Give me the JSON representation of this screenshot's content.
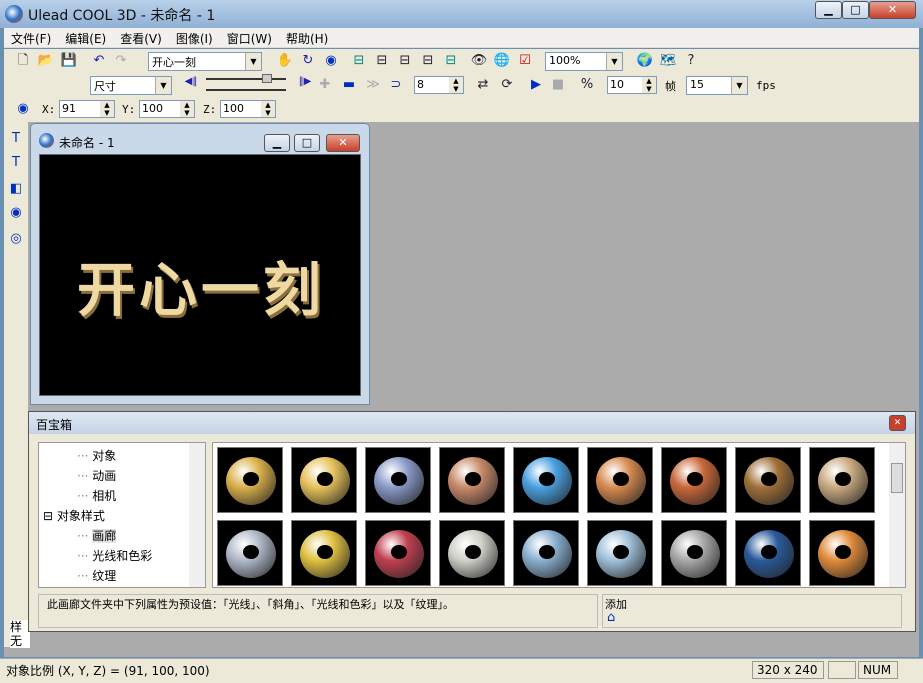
{
  "window": {
    "title": "Ulead COOL 3D - 未命名 - 1",
    "min": "▁",
    "max": "□",
    "close": "✕"
  },
  "menu": [
    "文件(F)",
    "编辑(E)",
    "查看(V)",
    "图像(I)",
    "窗口(W)",
    "帮助(H)"
  ],
  "toolbar1": {
    "text_combo": "开心一刻",
    "zoom_combo": "100%"
  },
  "toolbar2": {
    "attr_combo": "尺寸",
    "frame_value": "8",
    "frames_count": "10",
    "frames_label": "帧",
    "fps_value": "15",
    "fps_label": "fps"
  },
  "toolbar3": {
    "x_label": "X:",
    "x_value": "91",
    "y_label": "Y:",
    "y_value": "100",
    "z_label": "Z:",
    "z_value": "100"
  },
  "document": {
    "title": "未命名 - 1",
    "text": "开心一刻"
  },
  "library": {
    "title": "百宝箱",
    "tree": [
      {
        "label": "对象",
        "level": 2
      },
      {
        "label": "动画",
        "level": 2
      },
      {
        "label": "相机",
        "level": 2
      },
      {
        "label": "对象样式",
        "level": 1,
        "expanded": true
      },
      {
        "label": "画廊",
        "level": 2,
        "selected": true
      },
      {
        "label": "光线和色彩",
        "level": 2
      },
      {
        "label": "纹理",
        "level": 2
      }
    ],
    "thumb_colors": [
      "#d9b04a",
      "#e6c25a",
      "#8a9ac8",
      "#c88a6a",
      "#4aa0e0",
      "#d88a50",
      "#c8683a",
      "#a0703a",
      "#c8aa80",
      "#b0b8c8",
      "#e0c040",
      "#c04050",
      "#d0d0c8",
      "#8ab0d0",
      "#a0c0d8",
      "#a8a8a8",
      "#2a5a9a",
      "#e08a3a"
    ],
    "description": "此画廊文件夹中下列属性为预设值：「光线」、「斜角」、「光线和色彩」以及「纹理」。",
    "add_label": "添加"
  },
  "left_panel": {
    "tab": "样",
    "value": "无"
  },
  "status": {
    "message": "对象比例 (X, Y, Z) = (91, 100, 100)",
    "size": "320 x 240",
    "num": "NUM"
  }
}
